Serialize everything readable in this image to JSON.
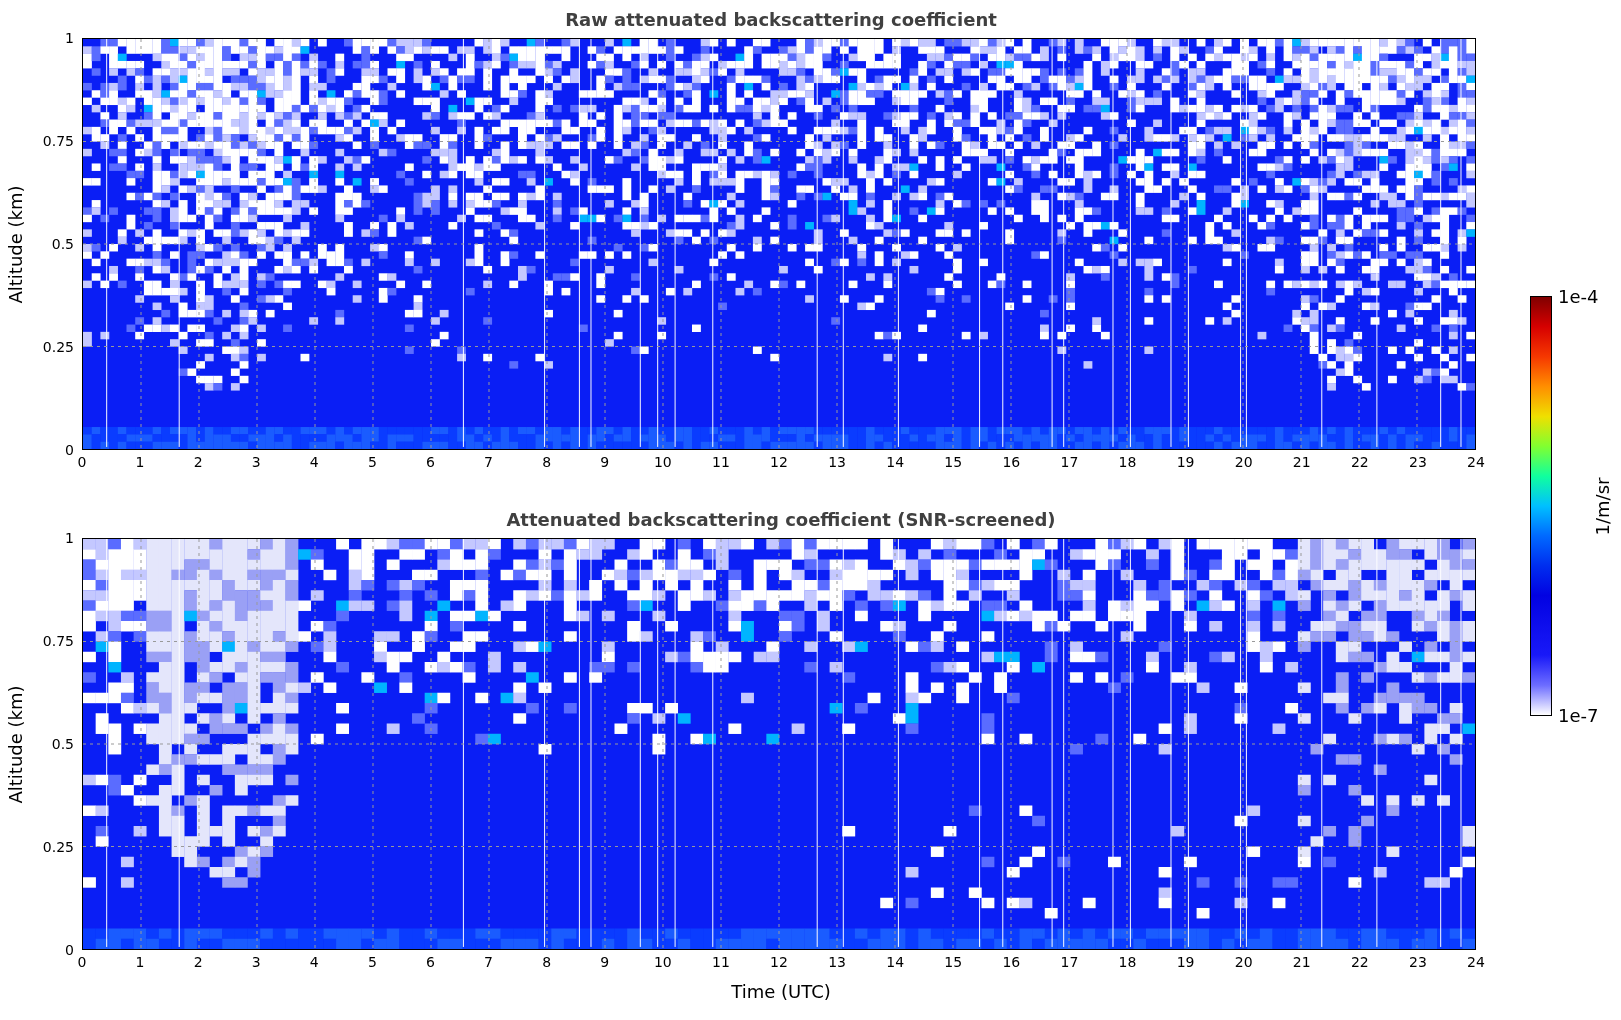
{
  "panels": [
    {
      "title": "Raw attenuated backscattering coefficient",
      "ylabel": "Altitude (km)",
      "yticks": [
        "1",
        "0.75",
        "0.5",
        "0.25",
        "0"
      ],
      "xticks": [
        "0",
        "1",
        "2",
        "3",
        "4",
        "5",
        "6",
        "7",
        "8",
        "9",
        "10",
        "11",
        "12",
        "13",
        "14",
        "15",
        "16",
        "17",
        "18",
        "19",
        "20",
        "21",
        "22",
        "23",
        "24"
      ],
      "kind": "raw"
    },
    {
      "title": "Attenuated backscattering coefficient (SNR-screened)",
      "ylabel": "Altitude (km)",
      "yticks": [
        "1",
        "0.75",
        "0.5",
        "0.25",
        "0"
      ],
      "xticks": [
        "0",
        "1",
        "2",
        "3",
        "4",
        "5",
        "6",
        "7",
        "8",
        "9",
        "10",
        "11",
        "12",
        "13",
        "14",
        "15",
        "16",
        "17",
        "18",
        "19",
        "20",
        "21",
        "22",
        "23",
        "24"
      ],
      "kind": "screened"
    }
  ],
  "xlabel": "Time (UTC)",
  "colorbar": {
    "max_label": "1e-4",
    "min_label": "1e-7",
    "unit": "1/m/sr"
  }
}
